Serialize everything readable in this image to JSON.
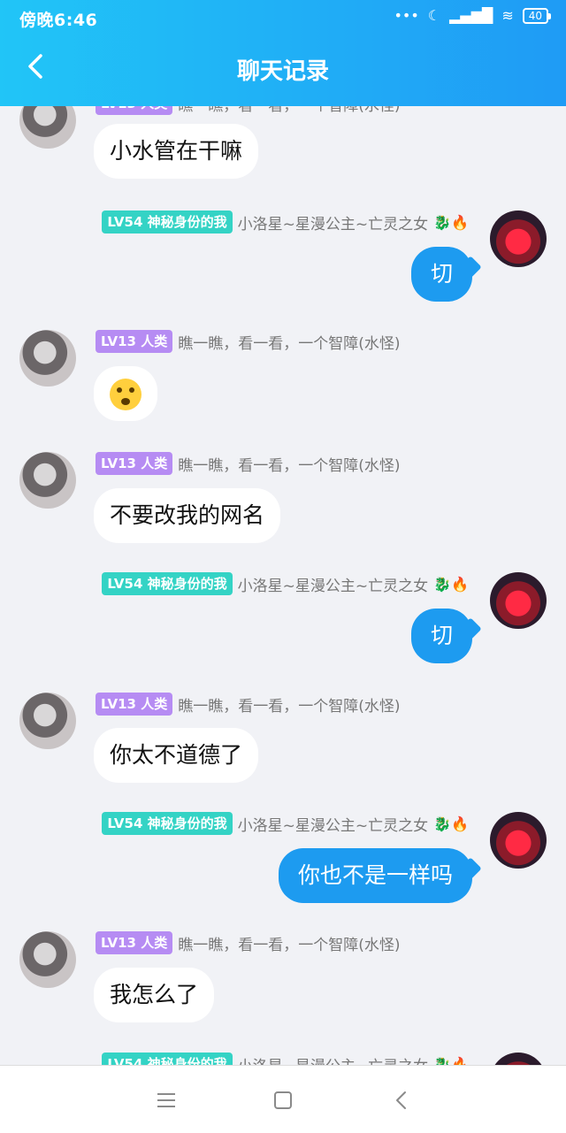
{
  "status": {
    "time": "傍晚6:46",
    "battery": "40"
  },
  "header": {
    "title": "聊天记录"
  },
  "users": {
    "left": {
      "level": "LV13",
      "role": "人类",
      "name": "瞧一瞧，看一看，一个智障(水怪)"
    },
    "right": {
      "level": "LV54",
      "role": "神秘身份的我",
      "name": "小洛星~星漫公主~亡灵之女"
    }
  },
  "messages": [
    {
      "side": "left",
      "text": "小水管在干嘛"
    },
    {
      "side": "right",
      "text": "切"
    },
    {
      "side": "left",
      "text": ""
    },
    {
      "side": "left",
      "text": "不要改我的网名"
    },
    {
      "side": "right",
      "text": "切"
    },
    {
      "side": "left",
      "text": "你太不道德了"
    },
    {
      "side": "right",
      "text": "你也不是一样吗"
    },
    {
      "side": "left",
      "text": "我怎么了"
    }
  ],
  "icons": {
    "back": "back-chevron-icon",
    "nav_menu": "menu-icon",
    "nav_home": "home-square-icon",
    "nav_back": "back-icon"
  },
  "colors": {
    "header_start": "#21c5f7",
    "header_end": "#1f9bf5",
    "bubble_right": "#1d9bf0",
    "badge_left": "#b68cf3",
    "badge_right": "#34d3c5"
  }
}
